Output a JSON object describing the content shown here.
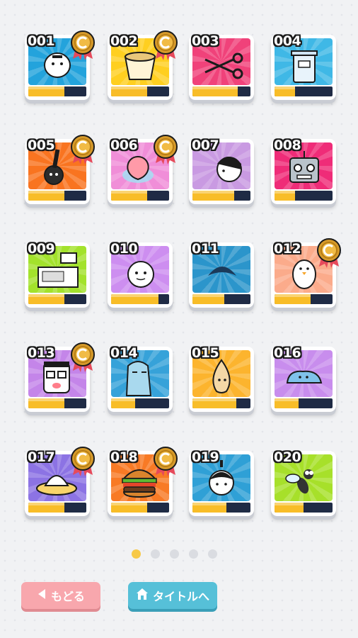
{
  "cards": [
    {
      "number": "001",
      "color": "#23a3dc",
      "medal": true,
      "progress": 0.62,
      "icon": "rice-ball-character-icon"
    },
    {
      "number": "002",
      "color": "#ffcf20",
      "medal": true,
      "progress": 0.62,
      "icon": "ramen-cup-icon"
    },
    {
      "number": "003",
      "color": "#f0427a",
      "medal": false,
      "progress": 0.78,
      "icon": "scissors-icon"
    },
    {
      "number": "004",
      "color": "#3fb8e6",
      "medal": false,
      "progress": 0.35,
      "icon": "trash-bin-icon"
    },
    {
      "number": "005",
      "color": "#f97420",
      "medal": true,
      "progress": 0.62,
      "icon": "bomb-character-icon"
    },
    {
      "number": "006",
      "color": "#f08ed8",
      "medal": true,
      "progress": 0.62,
      "icon": "peach-icon"
    },
    {
      "number": "007",
      "color": "#c99ae2",
      "medal": false,
      "progress": 0.72,
      "icon": "man-face-icon"
    },
    {
      "number": "008",
      "color": "#ef2c78",
      "medal": false,
      "progress": 0.35,
      "icon": "robot-head-icon"
    },
    {
      "number": "009",
      "color": "#a3e22c",
      "medal": false,
      "progress": 0.62,
      "icon": "cash-register-icon"
    },
    {
      "number": "010",
      "color": "#cd8ef0",
      "medal": false,
      "progress": 0.82,
      "icon": "round-character-icon"
    },
    {
      "number": "011",
      "color": "#2b95cb",
      "medal": false,
      "progress": 0.55,
      "icon": "fin-icon"
    },
    {
      "number": "012",
      "color": "#fbab8b",
      "medal": true,
      "progress": 0.62,
      "icon": "bird-character-icon"
    },
    {
      "number": "013",
      "color": "#c485e9",
      "medal": true,
      "progress": 0.62,
      "icon": "glasses-man-icon"
    },
    {
      "number": "014",
      "color": "#36a2d9",
      "medal": false,
      "progress": 0.42,
      "icon": "ghost-character-icon"
    },
    {
      "number": "015",
      "color": "#fcb42e",
      "medal": false,
      "progress": 0.75,
      "icon": "onion-icon"
    },
    {
      "number": "016",
      "color": "#c88ded",
      "medal": false,
      "progress": 0.42,
      "icon": "blob-character-icon"
    },
    {
      "number": "017",
      "color": "#8c73e4",
      "medal": true,
      "progress": 0.62,
      "icon": "ufo-character-icon"
    },
    {
      "number": "018",
      "color": "#f87a25",
      "medal": true,
      "progress": 0.62,
      "icon": "hamburger-icon"
    },
    {
      "number": "019",
      "color": "#2fa0d6",
      "medal": false,
      "progress": 0.58,
      "icon": "boy-face-icon"
    },
    {
      "number": "020",
      "color": "#a7e02a",
      "medal": false,
      "progress": 0.5,
      "icon": "fly-icon"
    }
  ],
  "pagination": {
    "pages": 5,
    "current": 0
  },
  "buttons": {
    "back_label": "もどる",
    "title_label": "タイトルへ"
  }
}
